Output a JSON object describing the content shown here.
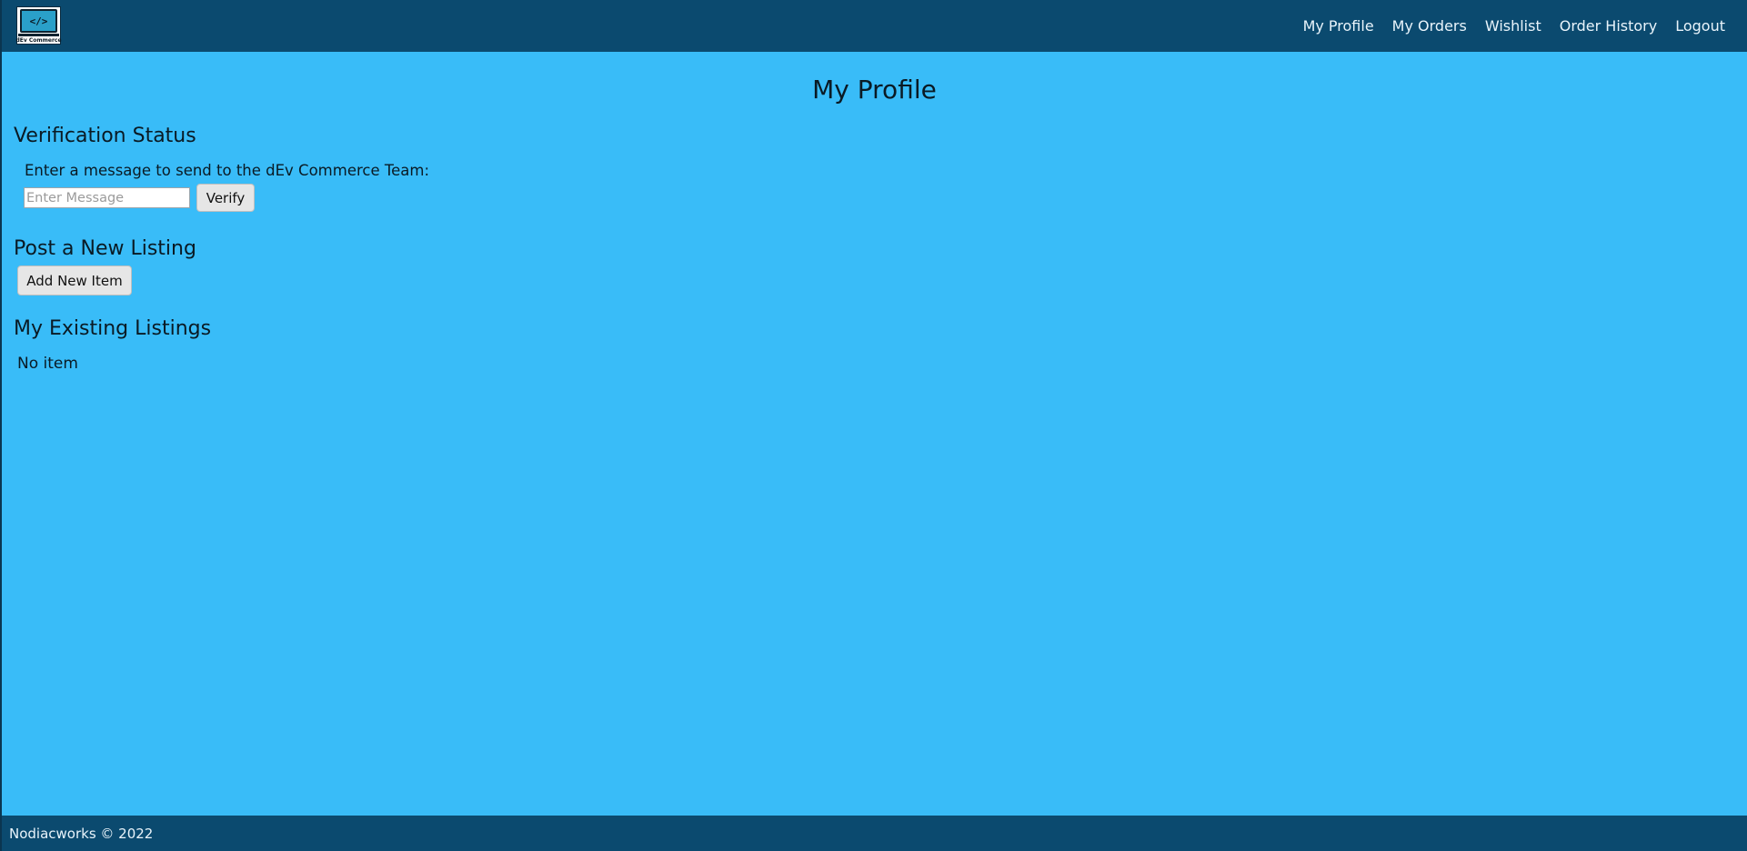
{
  "navbar": {
    "logo": {
      "icon": "code-brackets-icon",
      "screen_text": "</>",
      "brand_text": "dEv Commerce"
    },
    "links": [
      {
        "label": "My Profile"
      },
      {
        "label": "My Orders"
      },
      {
        "label": "Wishlist"
      },
      {
        "label": "Order History"
      },
      {
        "label": "Logout"
      }
    ]
  },
  "page": {
    "title": "My Profile"
  },
  "verification": {
    "heading": "Verification Status",
    "prompt": "Enter a message to send to the dEv Commerce Team:",
    "input_value": "",
    "input_placeholder": "Enter Message",
    "button_label": "Verify"
  },
  "new_listing": {
    "heading": "Post a New Listing",
    "button_label": "Add New Item"
  },
  "existing_listings": {
    "heading": "My Existing Listings",
    "empty_text": "No item"
  },
  "footer": {
    "text": "Nodiacworks © 2022"
  },
  "colors": {
    "navbar_bg": "#0b4a6f",
    "page_bg": "#39bcf8",
    "button_bg": "#e6e6e6",
    "nav_text": "#e9f4fb"
  }
}
